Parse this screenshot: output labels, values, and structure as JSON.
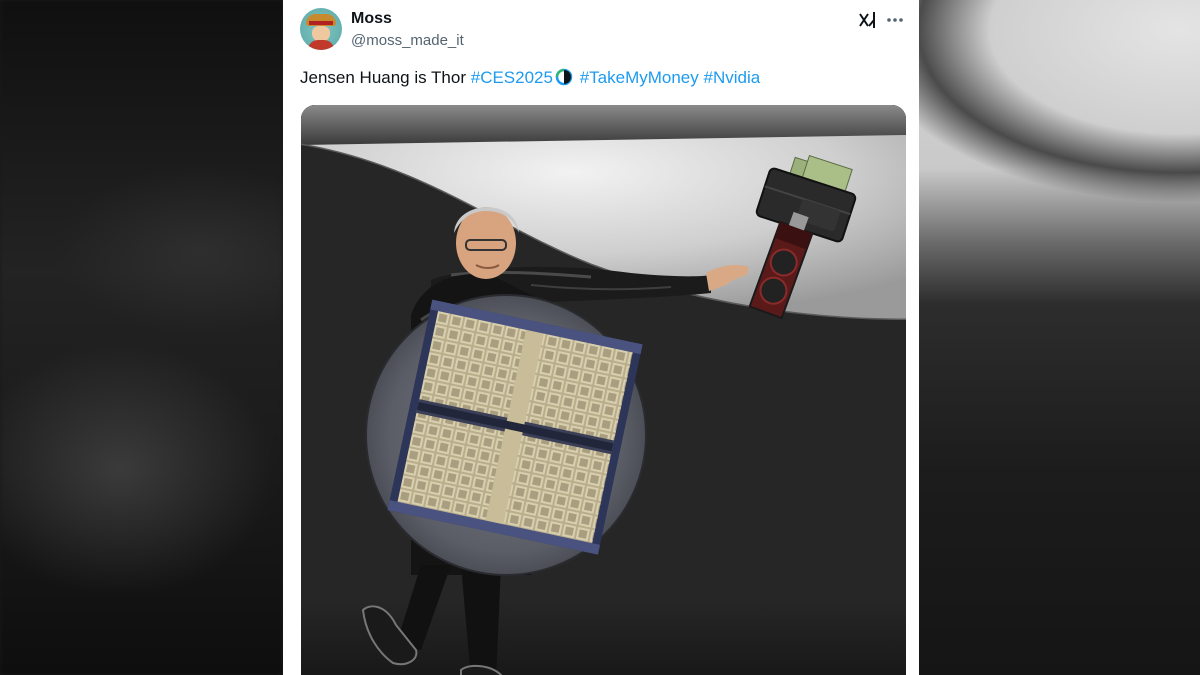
{
  "post": {
    "display_name": "Moss",
    "handle": "@moss_made_it",
    "text": {
      "prefix": "Jensen Huang is Thor ",
      "hashtags": [
        "#CES2025",
        "#TakeMyMoney",
        "#Nvidia"
      ]
    },
    "icons": {
      "avatar": "avatar-icon",
      "grok": "grok-icon",
      "more": "more-options-icon",
      "hashtag_emoji": "globe-icon"
    },
    "media": {
      "subject": "jensen-huang-meme-image",
      "elements": [
        "chip-wafer-shield-icon",
        "wallet-with-money-icon",
        "graphics-card-hammer-icon"
      ]
    }
  },
  "colors": {
    "link": "#1d9bf0",
    "text": "#0f1419",
    "secondary_text": "#536471"
  }
}
